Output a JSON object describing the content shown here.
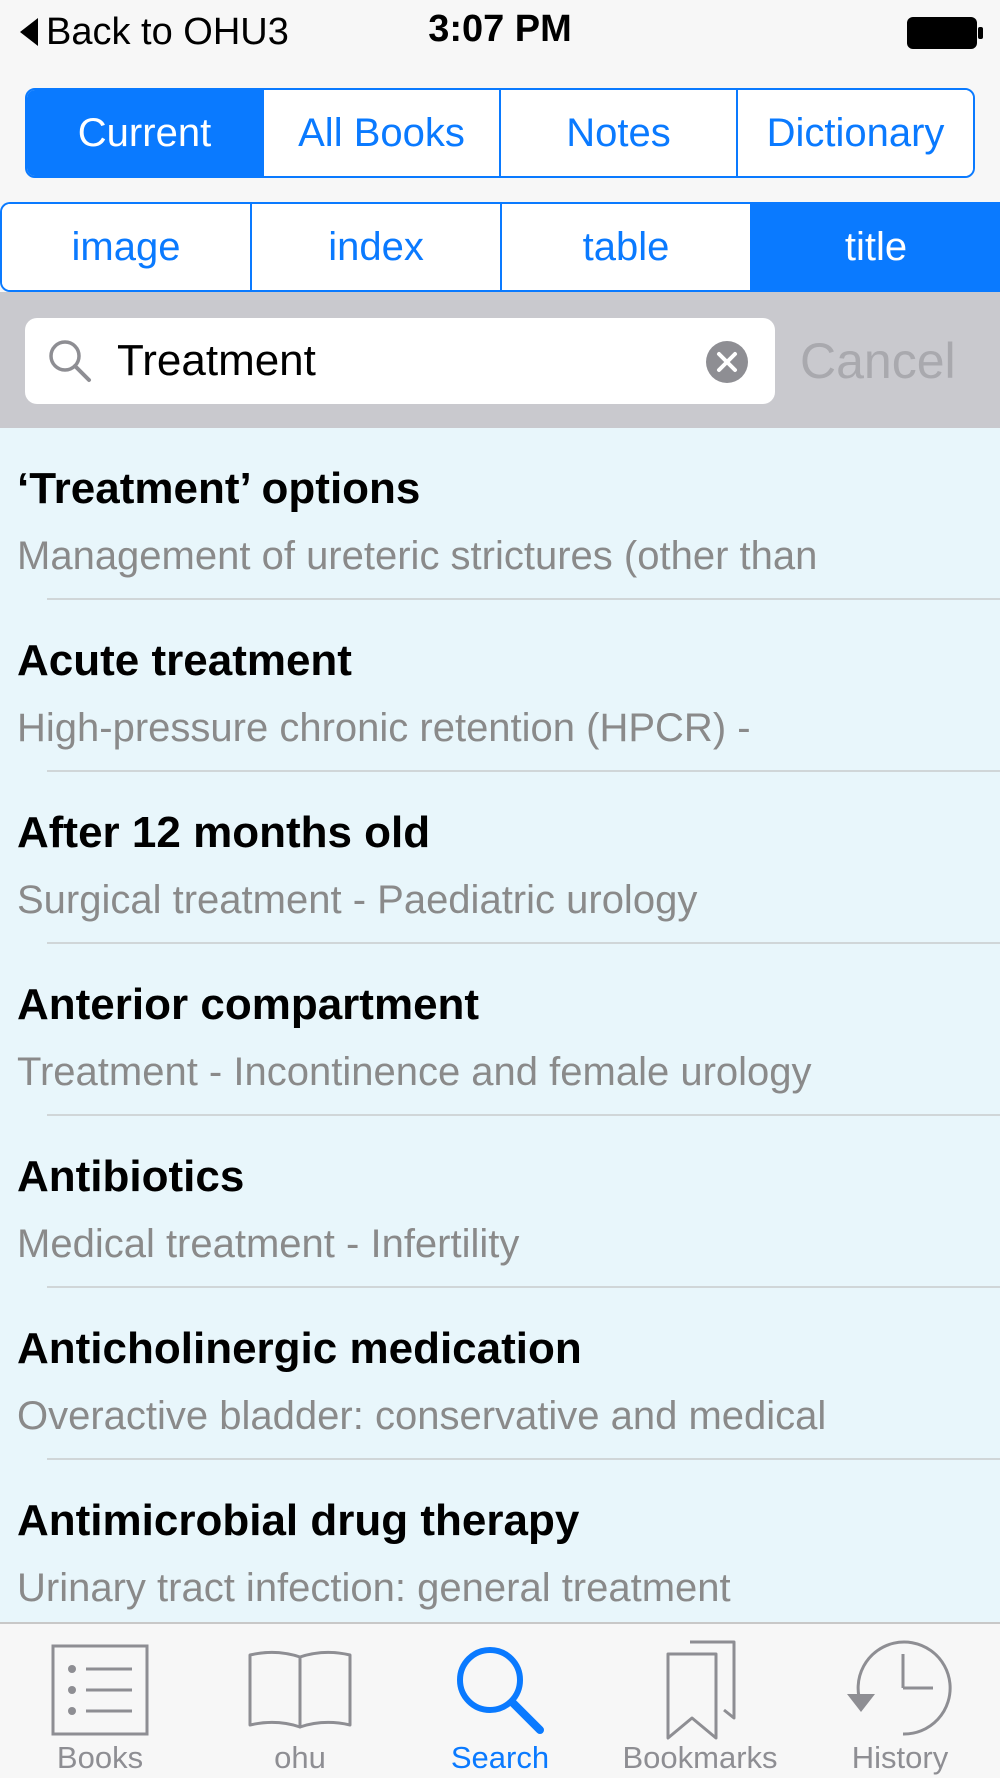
{
  "status_bar": {
    "back_label": "Back to OHU3",
    "time": "3:07 PM"
  },
  "scope_tabs": {
    "items": [
      {
        "label": "Current",
        "active": true
      },
      {
        "label": "All Books",
        "active": false
      },
      {
        "label": "Notes",
        "active": false
      },
      {
        "label": "Dictionary",
        "active": false
      }
    ]
  },
  "type_tabs": {
    "items": [
      {
        "label": "image",
        "active": false
      },
      {
        "label": "index",
        "active": false
      },
      {
        "label": "table",
        "active": false
      },
      {
        "label": "title",
        "active": true
      }
    ]
  },
  "search": {
    "value": "Treatment",
    "cancel_label": "Cancel"
  },
  "results": [
    {
      "title": "‘Treatment’ options",
      "subtitle": "Management of ureteric strictures (other than"
    },
    {
      "title": "Acute treatment",
      "subtitle": "High-pressure chronic retention (HPCR) -"
    },
    {
      "title": "After 12 months old",
      "subtitle": "Surgical treatment - Paediatric urology"
    },
    {
      "title": "Anterior compartment",
      "subtitle": "Treatment - Incontinence and female urology"
    },
    {
      "title": "Antibiotics",
      "subtitle": "Medical treatment - Infertility"
    },
    {
      "title": "Anticholinergic medication",
      "subtitle": "Overactive bladder: conservative and medical"
    },
    {
      "title": "Antimicrobial drug therapy",
      "subtitle": "Urinary tract infection: general treatment"
    }
  ],
  "tab_bar": {
    "items": [
      {
        "label": "Books",
        "icon": "list-icon",
        "active": false
      },
      {
        "label": "ohu",
        "icon": "open-book-icon",
        "active": false
      },
      {
        "label": "Search",
        "icon": "search-icon",
        "active": true
      },
      {
        "label": "Bookmarks",
        "icon": "bookmarks-icon",
        "active": false
      },
      {
        "label": "History",
        "icon": "history-clock-icon",
        "active": false
      }
    ]
  },
  "colors": {
    "accent": "#0a7aff",
    "results_background": "#e8f6fb",
    "search_band": "#c9c9ce",
    "muted_text": "#8a8a8a"
  }
}
